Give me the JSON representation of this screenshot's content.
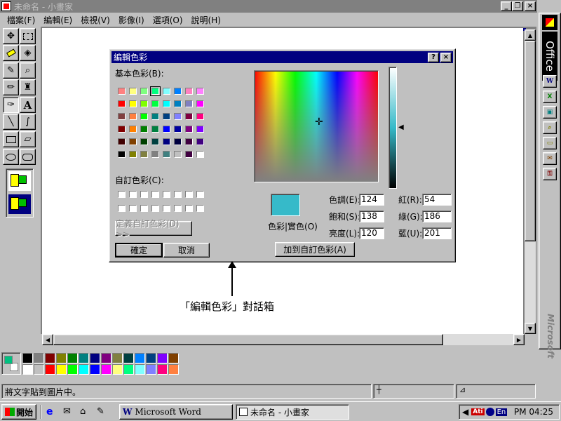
{
  "window": {
    "title": "未命名 - 小畫家"
  },
  "menu": [
    "檔案(F)",
    "編輯(E)",
    "檢視(V)",
    "影像(I)",
    "選項(O)",
    "說明(H)"
  ],
  "dialog": {
    "title": "編輯色彩",
    "basic_label": "基本色彩(B):",
    "custom_label": "自訂色彩(C):",
    "define_custom": "定義自訂色彩(D) >>",
    "ok": "確定",
    "cancel": "取消",
    "add_custom": "加到自訂色彩(A)",
    "color_solid": "色彩|實色(O)",
    "hue_label": "色調(E):",
    "sat_label": "飽和(S):",
    "lum_label": "亮度(L):",
    "red_label": "紅(R):",
    "green_label": "綠(G):",
    "blue_label": "藍(U):",
    "hue": "124",
    "sat": "138",
    "lum": "120",
    "red": "54",
    "green": "186",
    "blue": "201",
    "current_color": "#36bac9",
    "basic_colors": [
      [
        "#ff8080",
        "#ffff80",
        "#80ff80",
        "#00ff80",
        "#80ffff",
        "#0080ff",
        "#ff80c0",
        "#ff80ff"
      ],
      [
        "#ff0000",
        "#ffff00",
        "#80ff00",
        "#00ff40",
        "#00ffff",
        "#0080c0",
        "#8080c0",
        "#ff00ff"
      ],
      [
        "#804040",
        "#ff8040",
        "#00ff00",
        "#008080",
        "#004080",
        "#8080ff",
        "#800040",
        "#ff0080"
      ],
      [
        "#800000",
        "#ff8000",
        "#008000",
        "#008040",
        "#0000ff",
        "#0000a0",
        "#800080",
        "#8000ff"
      ],
      [
        "#400000",
        "#804000",
        "#004000",
        "#004040",
        "#000080",
        "#000040",
        "#400040",
        "#400080"
      ],
      [
        "#000000",
        "#808000",
        "#808040",
        "#808080",
        "#408080",
        "#c0c0c0",
        "#400040",
        "#ffffff"
      ]
    ]
  },
  "annotation": "「編輯色彩」對話箱",
  "status": "將文字貼到圖片中。",
  "palette": {
    "fg": "#00c080",
    "bg": "#ffffff",
    "top": [
      "#000000",
      "#808080",
      "#800000",
      "#808000",
      "#008000",
      "#008080",
      "#000080",
      "#800080",
      "#808040",
      "#004040",
      "#0080ff",
      "#004080",
      "#8000ff",
      "#804000"
    ],
    "bottom": [
      "#ffffff",
      "#c0c0c0",
      "#ff0000",
      "#ffff00",
      "#00ff00",
      "#00ffff",
      "#0000ff",
      "#ff00ff",
      "#ffff80",
      "#00ff80",
      "#80ffff",
      "#8080ff",
      "#ff0080",
      "#ff8040"
    ]
  },
  "office": {
    "label": "Office",
    "brand": "Microsoft"
  },
  "taskbar": {
    "start": "開始",
    "tasks": [
      "Microsoft Word",
      "未命名 - 小畫家"
    ],
    "clock": "PM 04:25",
    "lang": "En"
  }
}
